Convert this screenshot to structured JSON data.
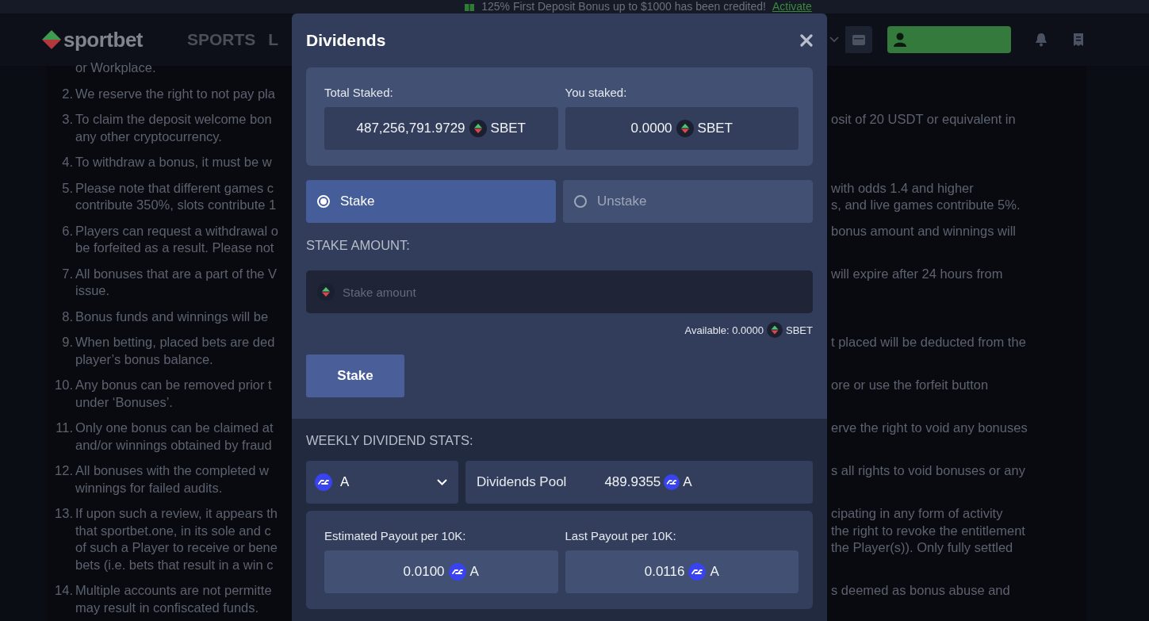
{
  "banner": {
    "text": "125% First Deposit Bonus up to $1000 has been credited!",
    "link": "Activate"
  },
  "header": {
    "logo": "sportbet",
    "nav": [
      "SPORTS",
      "L"
    ]
  },
  "terms": [
    {
      "lines": [
        {
          "left": "or Workplace."
        }
      ]
    },
    {
      "number": "2.",
      "lines": [
        {
          "left": "We reserve the right to not pay pla"
        }
      ]
    },
    {
      "number": "3.",
      "lines": [
        {
          "left": "To claim the deposit welcome bon",
          "right": "osit of 20 USDT or equivalent in"
        },
        {
          "left": "any other cryptocurrency."
        }
      ]
    },
    {
      "number": "4.",
      "lines": [
        {
          "left": "To withdraw a bonus, it must be w"
        }
      ]
    },
    {
      "number": "5.",
      "lines": [
        {
          "left": "Please note that different games c",
          "right": "with odds 1.4 and higher"
        },
        {
          "left": "contribute 350%, slots contribute 1",
          "right": "s, and live games contribute 5%."
        }
      ]
    },
    {
      "number": "6.",
      "lines": [
        {
          "left": "Players can request a withdrawal o",
          "right": "bonus amount and winnings will"
        },
        {
          "left": "be forfeited as a result. Please not"
        }
      ]
    },
    {
      "number": "7.",
      "lines": [
        {
          "left": "All bonuses that are a part of the V",
          "right": "will expire after 24 hours from"
        },
        {
          "left": "issue."
        }
      ]
    },
    {
      "number": "8.",
      "lines": [
        {
          "left": "Bonus funds and winnings will be"
        }
      ]
    },
    {
      "number": "9.",
      "lines": [
        {
          "left": "When betting, placed bets are ded",
          "right": "t placed will be deducted from the"
        },
        {
          "left": "player’s bonus balance."
        }
      ]
    },
    {
      "number": "10.",
      "lines": [
        {
          "left": "Any bonus can be removed prior t",
          "right": "ore or use the forfeit button"
        },
        {
          "left": "under ‘Bonuses’."
        }
      ]
    },
    {
      "number": "11.",
      "lines": [
        {
          "left": "Only one bonus can be claimed at",
          "right": "erve the right to void any bonuses"
        },
        {
          "left": "and/or winnings obtained by fraud"
        }
      ]
    },
    {
      "number": "12.",
      "lines": [
        {
          "left": "All bonuses with the completed w",
          "right": "s all rights to void bonuses or any"
        },
        {
          "left": "winnings for failed audits."
        }
      ]
    },
    {
      "number": "13.",
      "lines": [
        {
          "left": "If upon such a review, it appears th",
          "right": "cipating in any form of activity"
        },
        {
          "left": "that sportbet.one, in its sole and c",
          "right": "the right to revoke the entitlement"
        },
        {
          "left": "of such a Player to receive or bene",
          "right": "the Player(s)). Only fully settled"
        },
        {
          "left": "bets (i.e. bets that result in a win c"
        }
      ]
    },
    {
      "number": "14.",
      "lines": [
        {
          "left": "Multiple accounts are not permitte",
          "right": "s deemed as bonus abuse and"
        },
        {
          "left": "may result in confiscated funds."
        }
      ]
    }
  ],
  "modal": {
    "title": "Dividends",
    "stakes": [
      {
        "label": "Total Staked:",
        "value": "487,256,791.9729",
        "unit": "SBET",
        "kind": "sbet"
      },
      {
        "label": "You staked:",
        "value": "0.0000",
        "unit": "SBET",
        "kind": "sbet"
      }
    ],
    "modes": [
      {
        "label": "Stake",
        "selected": true
      },
      {
        "label": "Unstake",
        "selected": false
      }
    ],
    "amount_label": "STAKE AMOUNT:",
    "amount_field": {
      "placeholder": "Stake amount",
      "kind": "sbet"
    },
    "available": {
      "label": "Available: 0.0000",
      "unit": "SBET",
      "kind": "sbet"
    },
    "submit": "Stake",
    "stats_title": "WEEKLY DIVIDEND STATS:",
    "currency_select": {
      "value": "A",
      "kind": "token"
    },
    "pool": {
      "label": "Dividends Pool",
      "value": "489.9355",
      "unit": "A",
      "kind": "token"
    },
    "payouts": [
      {
        "label": "Estimated Payout per 10K:",
        "value": "0.0100",
        "unit": "A",
        "kind": "token"
      },
      {
        "label": "Last Payout per 10K:",
        "value": "0.0116",
        "unit": "A",
        "kind": "token"
      }
    ]
  }
}
